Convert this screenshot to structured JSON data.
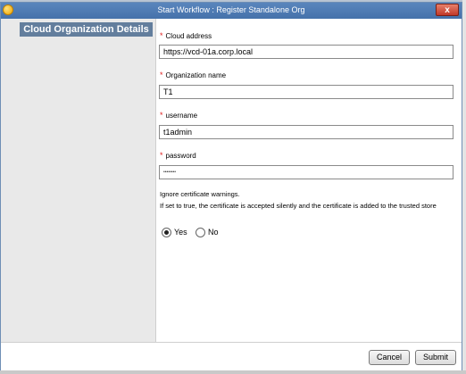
{
  "window": {
    "title": "Start Workflow : Register Standalone Org",
    "close_glyph": "x"
  },
  "sidebar": {
    "items": [
      {
        "label": "Cloud Organization Details"
      }
    ]
  },
  "form": {
    "required_mark": "*",
    "fields": [
      {
        "label": "Cloud address",
        "value": "https://vcd-01a.corp.local"
      },
      {
        "label": "Organization name",
        "value": "T1"
      },
      {
        "label": "username",
        "value": "t1admin"
      },
      {
        "label": "password",
        "value": "••••••••"
      }
    ],
    "ignore_cert": {
      "title": "Ignore certificate warnings.",
      "description": "If set to true, the certificate is accepted silently and the certificate is added to the trusted store",
      "options": [
        {
          "label": "Yes",
          "selected": true
        },
        {
          "label": "No",
          "selected": false
        }
      ]
    }
  },
  "footer": {
    "cancel_label": "Cancel",
    "submit_label": "Submit"
  }
}
